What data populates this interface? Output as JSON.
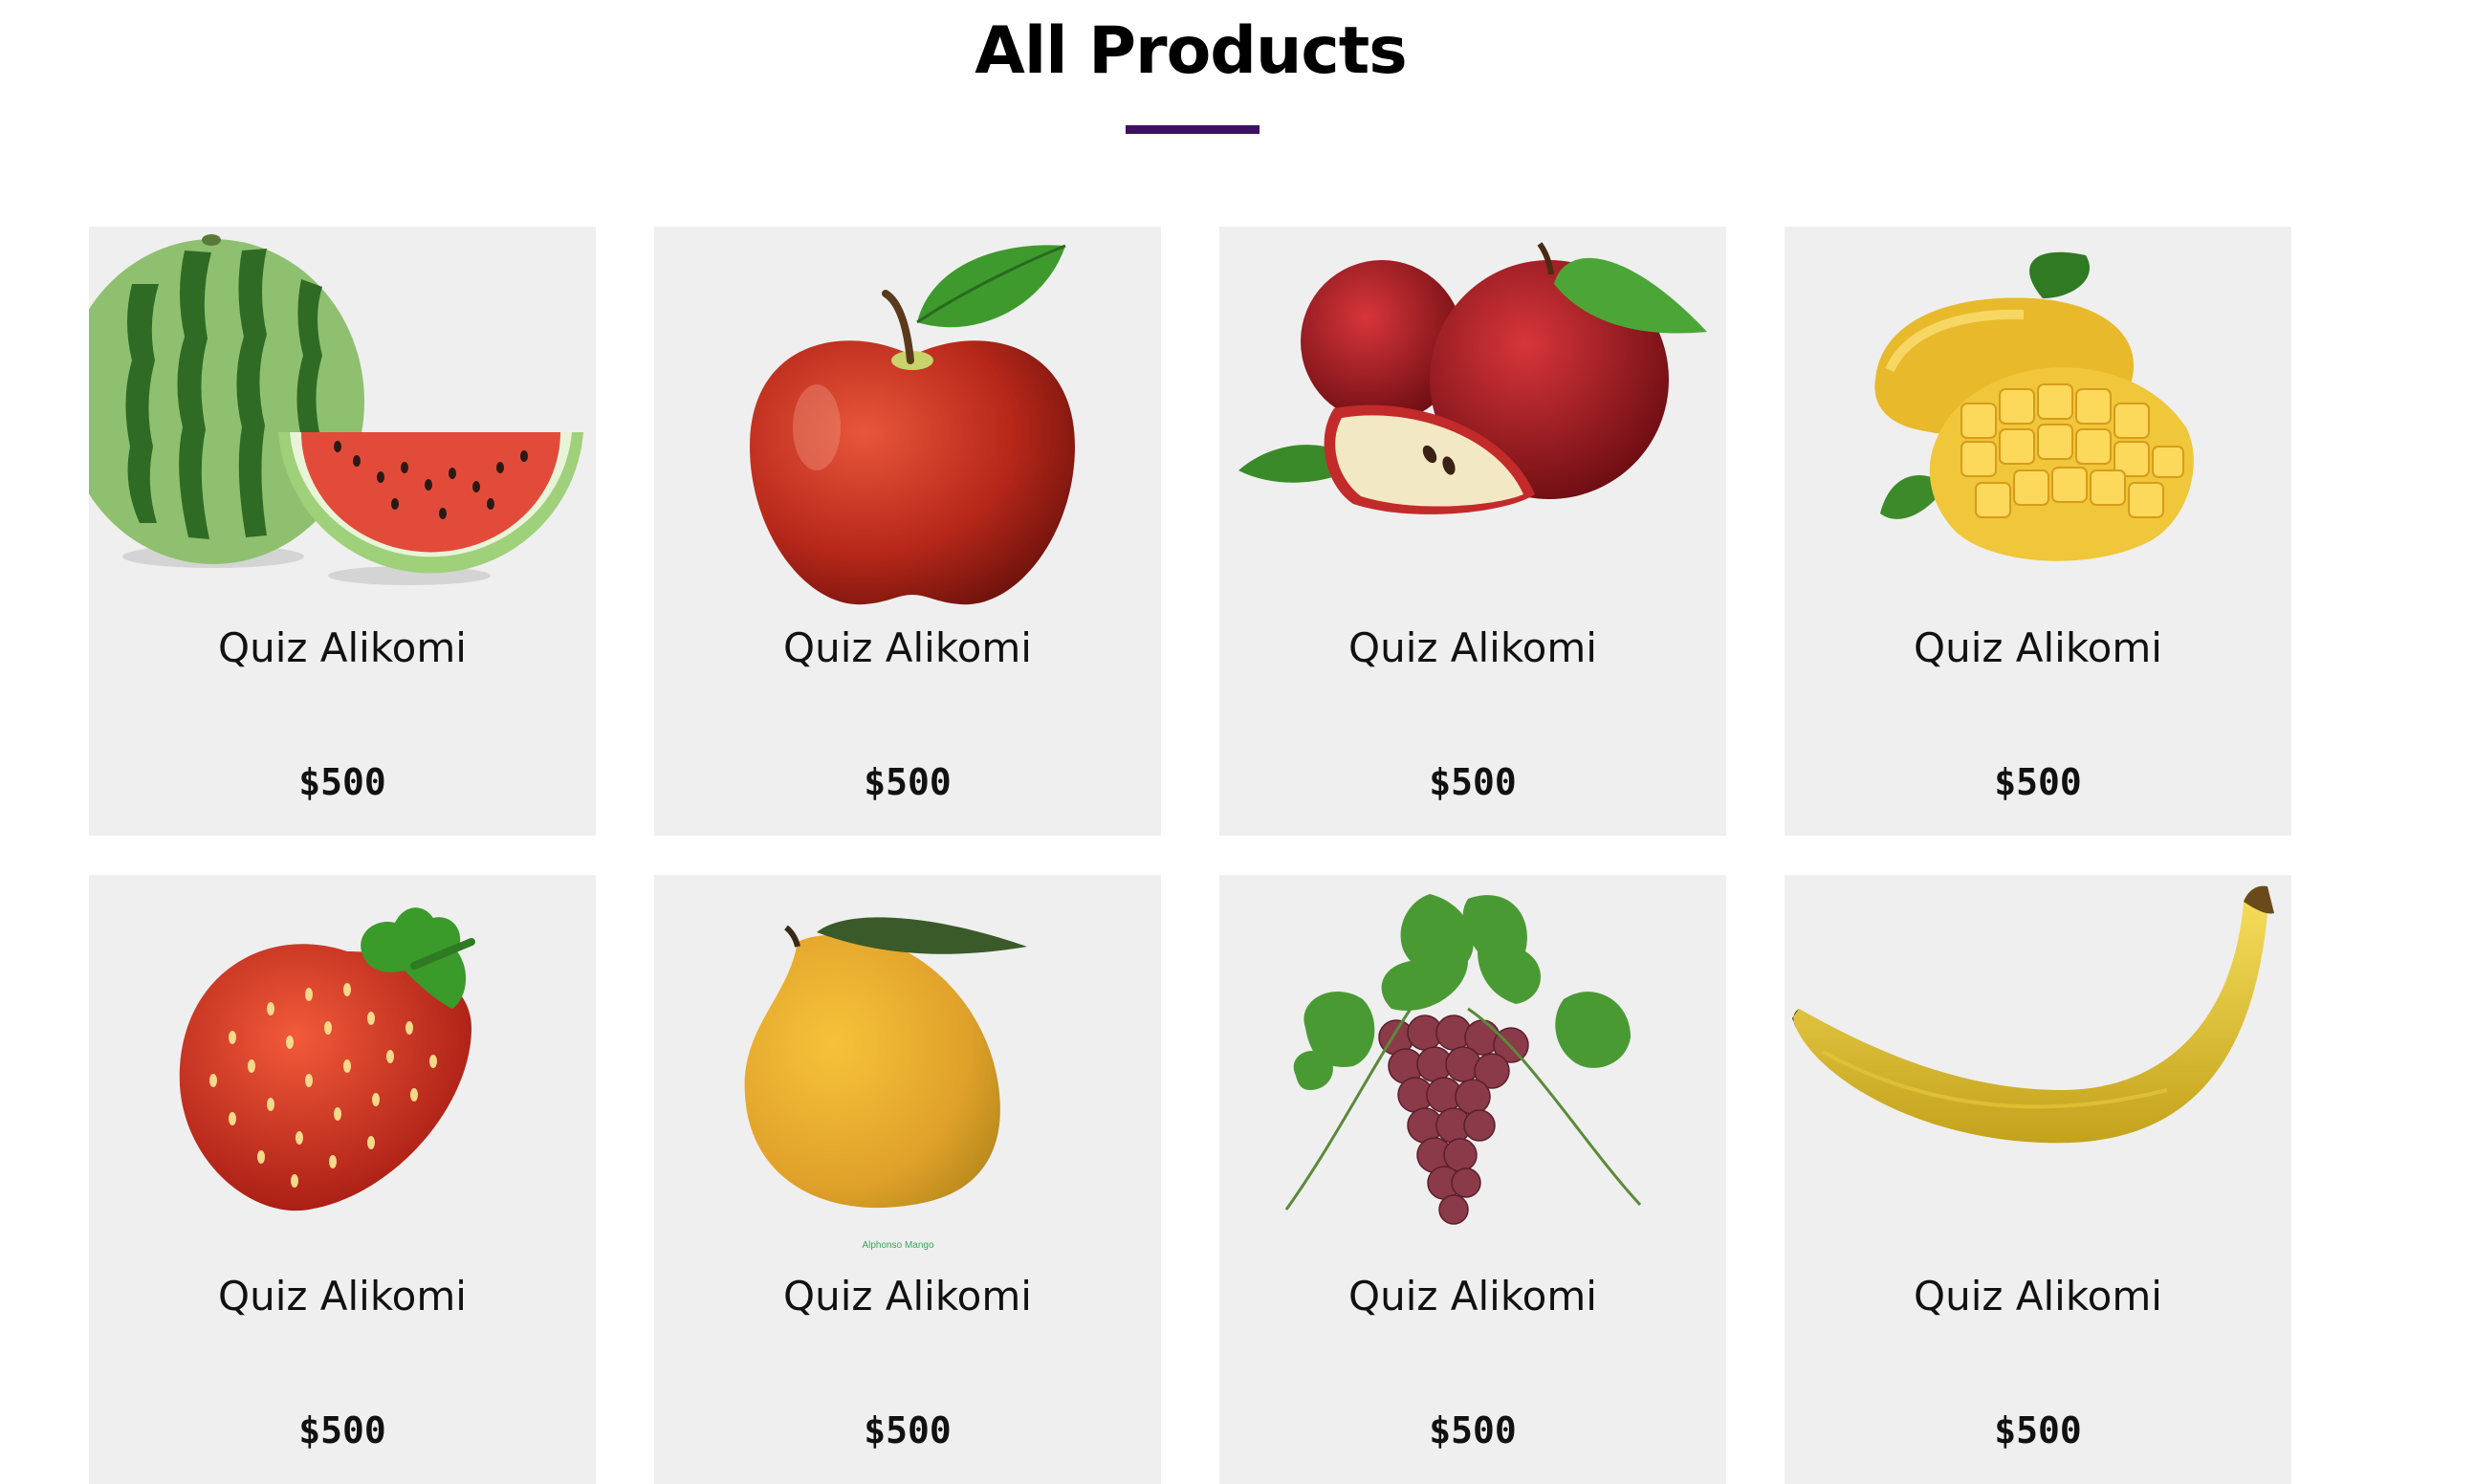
{
  "page": {
    "title": "All Products",
    "accent_color": "#3d1060"
  },
  "products": [
    {
      "name": "Quiz Alikomi",
      "price": "$500",
      "image": "watermelon"
    },
    {
      "name": "Quiz Alikomi",
      "price": "$500",
      "image": "apple"
    },
    {
      "name": "Quiz Alikomi",
      "price": "$500",
      "image": "apples-with-slice"
    },
    {
      "name": "Quiz Alikomi",
      "price": "$500",
      "image": "mango-cut"
    },
    {
      "name": "Quiz Alikomi",
      "price": "$500",
      "image": "strawberry"
    },
    {
      "name": "Quiz Alikomi",
      "price": "$500",
      "image": "alphonso-mango",
      "image_caption": "Alphonso Mango"
    },
    {
      "name": "Quiz Alikomi",
      "price": "$500",
      "image": "grapes"
    },
    {
      "name": "Quiz Alikomi",
      "price": "$500",
      "image": "banana"
    }
  ]
}
